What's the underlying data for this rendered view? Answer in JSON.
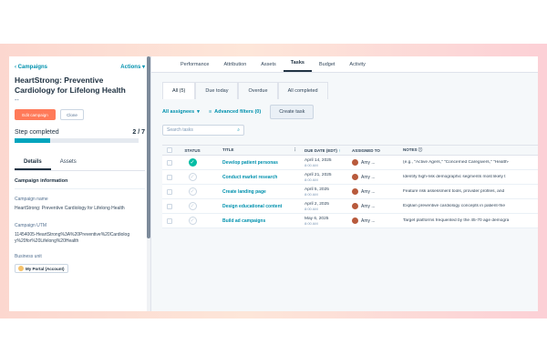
{
  "left": {
    "back_link": "Campaigns",
    "actions_label": "Actions",
    "title": "HeartStrong: Preventive Cardiology for Lifelong Health",
    "subtitle": "--",
    "edit_button": "Edit campaign",
    "clone_button": "Clone",
    "step_label": "Step completed",
    "step_count": "2 / 7",
    "step_progress": 0.29,
    "tabs": [
      {
        "label": "Details"
      },
      {
        "label": "Assets"
      }
    ],
    "section_title": "Campaign information",
    "fields": {
      "name_label": "Campaign name",
      "name_value": "HeartStrong: Preventive Cardiology for Lifelong Health",
      "utm_label": "Campaign UTM",
      "utm_value": "11454005-HeartStrong%3A%20Preventive%20Cardiology%20for%20Lifelong%20Health",
      "bu_label": "Business unit",
      "bu_value": "My Portal (Account)"
    }
  },
  "right": {
    "top_tabs": [
      {
        "label": "Performance"
      },
      {
        "label": "Attribution"
      },
      {
        "label": "Assets"
      },
      {
        "label": "Tasks"
      },
      {
        "label": "Budget"
      },
      {
        "label": "Activity"
      }
    ],
    "filter_tabs": [
      {
        "label": "All (5)"
      },
      {
        "label": "Due today"
      },
      {
        "label": "Overdue"
      },
      {
        "label": "All completed"
      }
    ],
    "assignees_filter": "All assignees",
    "advanced_filters": "Advanced filters (0)",
    "create_task": "Create task",
    "search_placeholder": "Search tasks",
    "columns": {
      "status": "STATUS",
      "title": "TITLE",
      "due": "DUE DATE (EDT)",
      "assigned": "ASSIGNED TO",
      "notes": "NOTES"
    },
    "rows": [
      {
        "title": "Develop patient personas",
        "date": "April 14, 2025",
        "time": "8:00 AM",
        "assignee": "Amy ...",
        "note": "(e.g., \"Active Agers,\" \"Concerned Caregivers,\" \"Health-",
        "done": true
      },
      {
        "title": "Conduct market research",
        "date": "April 21, 2025",
        "time": "8:00 AM",
        "assignee": "Amy ...",
        "note": "Identify high-risk demographic segments most likely t",
        "done": false
      },
      {
        "title": "Create landing page",
        "date": "April 5, 2025",
        "time": "8:00 AM",
        "assignee": "Amy ...",
        "note": "Feature risk assessment tools, provider profiles, and",
        "done": false
      },
      {
        "title": "Design educational content",
        "date": "April 2, 2025",
        "time": "8:00 AM",
        "assignee": "Amy ...",
        "note": "Explain preventive cardiology concepts in patient-frie",
        "done": false
      },
      {
        "title": "Build ad campaigns",
        "date": "May 6, 2025",
        "time": "8:00 AM",
        "assignee": "Amy ...",
        "note": "Target platforms frequented by the 45-70 age demogra",
        "done": false
      }
    ]
  },
  "colors": {
    "accent": "#0091ae",
    "orange": "#ff7a59",
    "progress": "#00a4bd",
    "done": "#00bda5"
  }
}
